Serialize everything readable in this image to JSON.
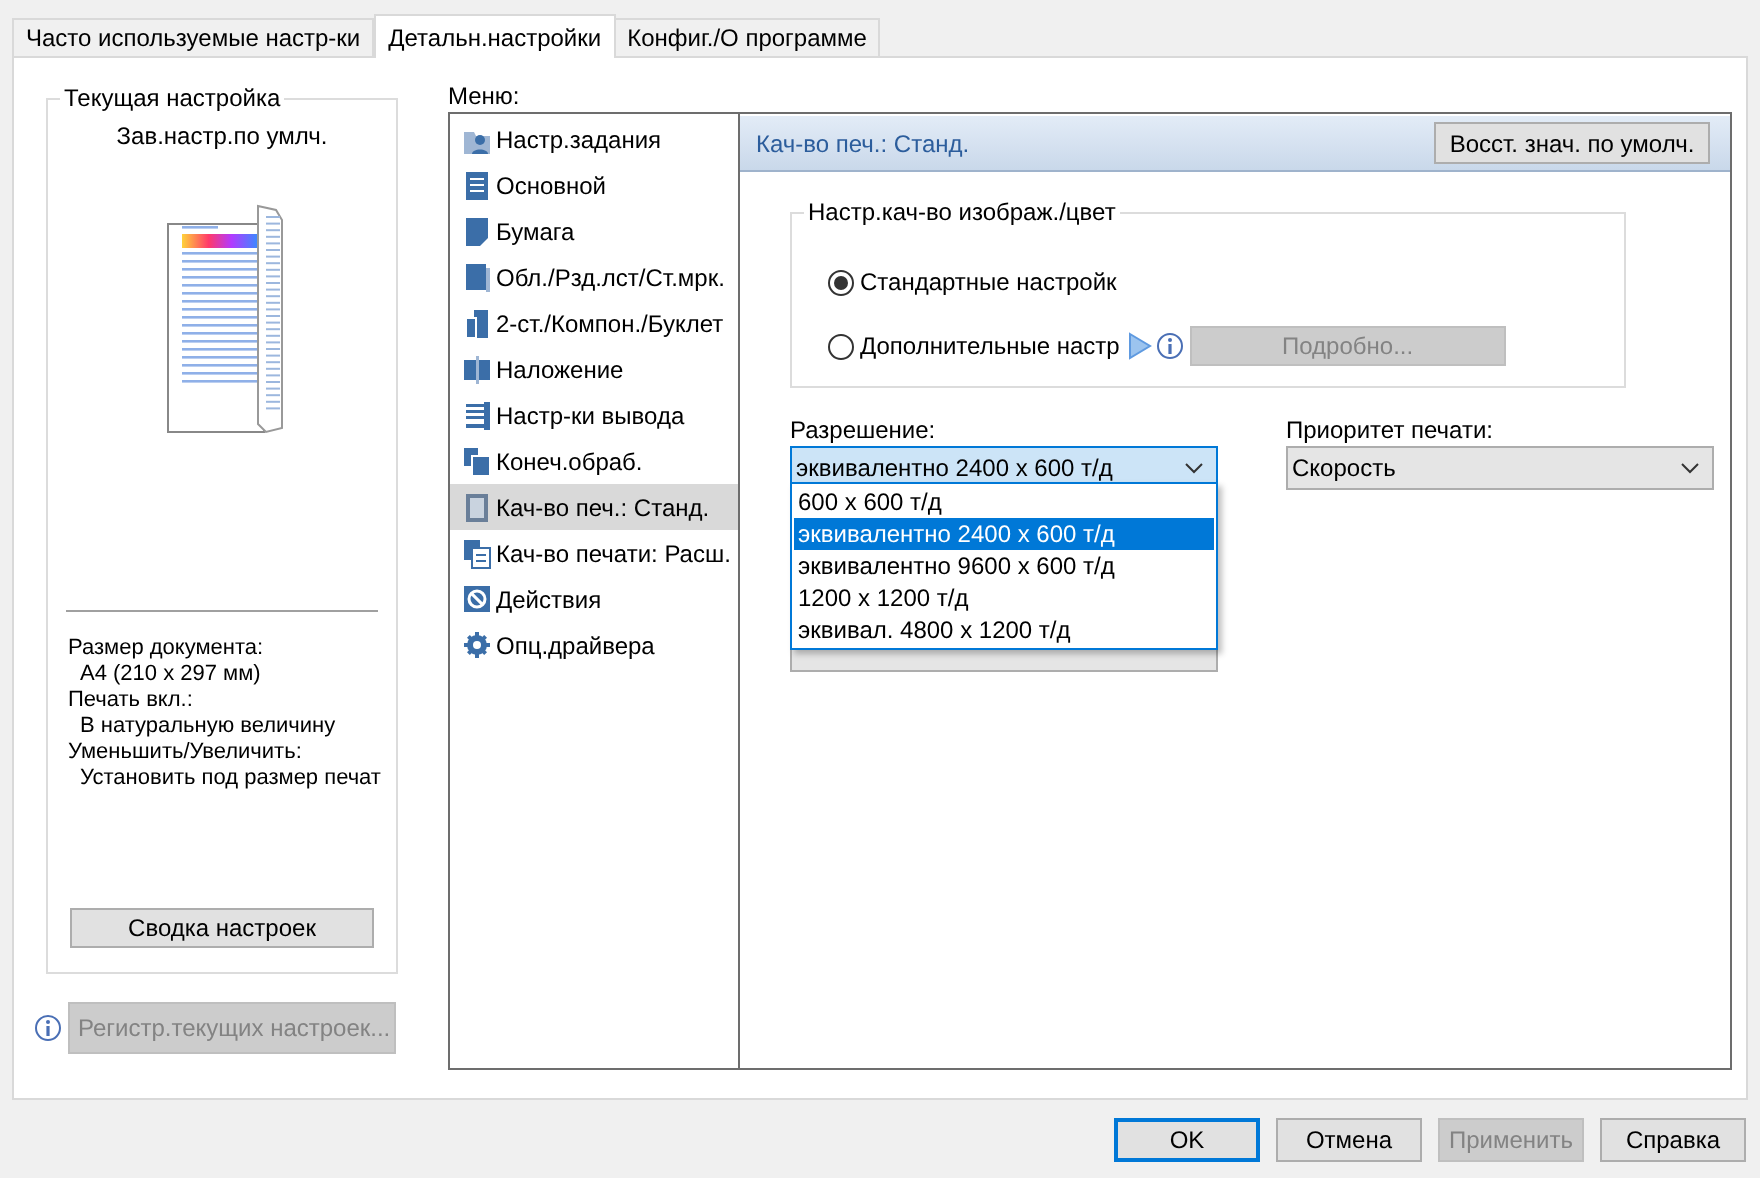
{
  "tabs": [
    {
      "label": "Часто используемые настр-ки",
      "selected": false
    },
    {
      "label": "Детальн.настройки",
      "selected": true
    },
    {
      "label": "Конфиг./О программе",
      "selected": false
    }
  ],
  "current_setting": {
    "title": "Текущая настройка",
    "name": "Зав.настр.по умлч.",
    "info": [
      {
        "kind": "label",
        "text": "Размер документа:"
      },
      {
        "kind": "value",
        "text": "A4 (210 x 297 мм)"
      },
      {
        "kind": "label",
        "text": "Печать вкл.:"
      },
      {
        "kind": "value",
        "text": "В натуральную величину"
      },
      {
        "kind": "label",
        "text": "Уменьшить/Увеличить:"
      },
      {
        "kind": "value",
        "text": "Установить под размер печат"
      }
    ],
    "summary_button": "Сводка настроек"
  },
  "register_button": {
    "label": "Регистр.текущих настроек...",
    "disabled": true
  },
  "menu": {
    "label": "Меню:",
    "items": [
      {
        "label": "Настр.задания",
        "selected": false
      },
      {
        "label": "Основной",
        "selected": false
      },
      {
        "label": "Бумага",
        "selected": false
      },
      {
        "label": "Обл./Рзд.лст/Ст.мрк.",
        "selected": false
      },
      {
        "label": "2-ст./Компон./Буклет",
        "selected": false
      },
      {
        "label": "Наложение",
        "selected": false
      },
      {
        "label": "Настр-ки вывода",
        "selected": false
      },
      {
        "label": "Конеч.обраб.",
        "selected": false
      },
      {
        "label": "Кач-во печ.: Станд.",
        "selected": true
      },
      {
        "label": "Кач-во печати: Расш.",
        "selected": false
      },
      {
        "label": "Действия",
        "selected": false
      },
      {
        "label": "Опц.драйвера",
        "selected": false
      }
    ]
  },
  "panel": {
    "title": "Кач-во печ.: Станд.",
    "restore_button": "Восст. знач. по умолч.",
    "image_group": {
      "title": "Настр.кач-во изображ./цвет",
      "options": [
        {
          "label": "Стандартные настройк",
          "selected": true
        },
        {
          "label": "Дополнительные настр",
          "selected": false
        }
      ],
      "details_button": {
        "label": "Подробно...",
        "disabled": true
      }
    },
    "resolution": {
      "label": "Разрешение:",
      "value": "эквивалентно 2400 x 600 т/д",
      "expanded": true,
      "options": [
        {
          "label": "600 x 600 т/д",
          "selected": false
        },
        {
          "label": "эквивалентно 2400 x 600 т/д",
          "selected": true
        },
        {
          "label": "эквивалентно 9600 x 600 т/д",
          "selected": false
        },
        {
          "label": "1200 x 1200 т/д",
          "selected": false
        },
        {
          "label": "эквивал. 4800 x 1200 т/д",
          "selected": false
        }
      ]
    },
    "priority": {
      "label": "Приоритет печати:",
      "value": "Скорость"
    }
  },
  "buttons": [
    {
      "label": "OK",
      "disabled": false,
      "default": true
    },
    {
      "label": "Отмена",
      "disabled": false,
      "default": false
    },
    {
      "label": "Применить",
      "disabled": true,
      "default": false
    },
    {
      "label": "Справка",
      "disabled": false,
      "default": false
    }
  ]
}
